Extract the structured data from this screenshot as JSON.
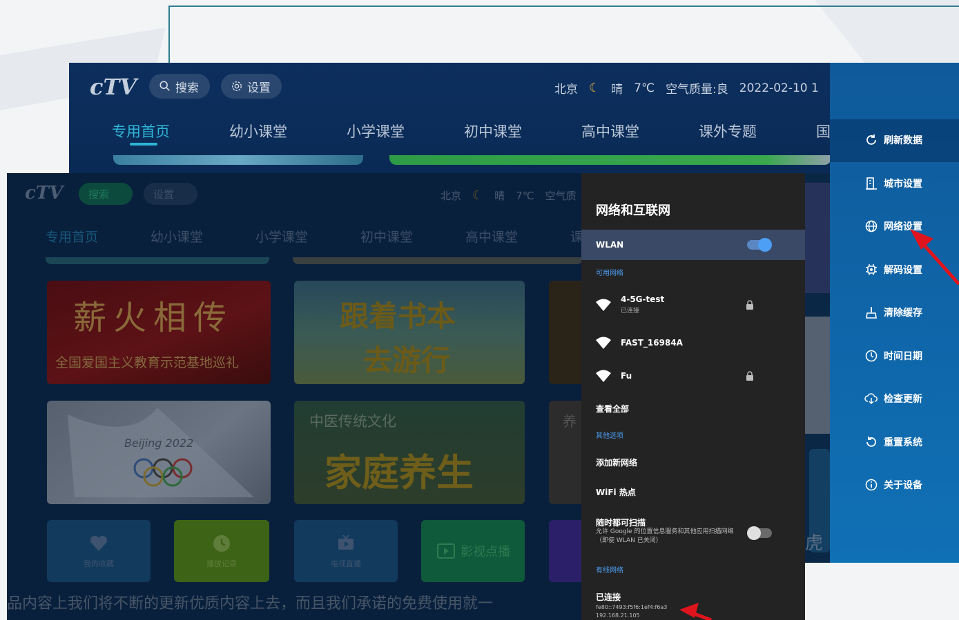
{
  "app": {
    "logo": "cTV"
  },
  "top_bar": {
    "search_label": "搜索",
    "settings_label": "设置",
    "city": "北京",
    "weather": "晴",
    "temperature": "7℃",
    "air_quality": "空气质量:良",
    "datetime": "2022-02-10 1"
  },
  "front_status": {
    "city": "北京",
    "weather": "晴",
    "temperature": "7℃",
    "air_quality": "空气质"
  },
  "nav_tabs_back": [
    "专用首页",
    "幼小课堂",
    "小学课堂",
    "初中课堂",
    "高中课堂",
    "课外专题",
    "国"
  ],
  "nav_tabs_front": [
    "专用首页",
    "幼小课堂",
    "小学课堂",
    "初中课堂",
    "高中课堂",
    "课"
  ],
  "cards": {
    "card1_title": "薪火相传",
    "card1_subtitle": "全国爱国主义教育示范基地巡礼",
    "card2_line1": "跟着书本",
    "card2_line2": "去游行",
    "card4_text": "Beijing 2022",
    "card5_top": "中医传统文化",
    "card5_title": "家庭养生",
    "card6_text": "养"
  },
  "tiles": [
    "我的收藏",
    "播放记录",
    "电视直播",
    "影视点播"
  ],
  "ticker": "品内容上我们将不断的更新优质内容上去，而且我们承诺的免费使用就一",
  "edge_text": "虎",
  "sidebar_menu": [
    {
      "label": "刷新数据",
      "icon": "refresh-icon"
    },
    {
      "label": "城市设置",
      "icon": "building-icon"
    },
    {
      "label": "网络设置",
      "icon": "globe-icon"
    },
    {
      "label": "解码设置",
      "icon": "chip-icon"
    },
    {
      "label": "清除缓存",
      "icon": "broom-icon"
    },
    {
      "label": "时间日期",
      "icon": "clock-icon"
    },
    {
      "label": "检查更新",
      "icon": "cloud-download-icon"
    },
    {
      "label": "重置系统",
      "icon": "reset-icon"
    },
    {
      "label": "关于设备",
      "icon": "info-icon"
    }
  ],
  "network_panel": {
    "title": "网络和互联网",
    "wlan_label": "WLAN",
    "wlan_on": true,
    "available_header": "可用网络",
    "networks": [
      {
        "name": "4-5G-test",
        "status": "已连接",
        "locked": true
      },
      {
        "name": "FAST_16984A",
        "status": "",
        "locked": false
      },
      {
        "name": "Fu",
        "status": "",
        "locked": true
      }
    ],
    "see_all": "查看全部",
    "other_header": "其他选项",
    "add_network": "添加新网络",
    "hotspot": "WiFi 热点",
    "scan_title": "随时都可扫描",
    "scan_desc": "允许 Google 的位置信息服务和其他应用扫描网络（即使 WLAN 已关闭）",
    "scan_on": false,
    "wired_header": "有线网络",
    "wired_status": "已连接",
    "wired_ipv6": "fe80::7493:f5f6:1ef4:f6a3",
    "wired_ipv4": "192.168.21.105"
  },
  "colors": {
    "accent_blue": "#4c9ff5",
    "active_tab": "#2fb5d6",
    "sidebar_blue": "#0f65a8",
    "annotation_red": "#e0141c"
  }
}
